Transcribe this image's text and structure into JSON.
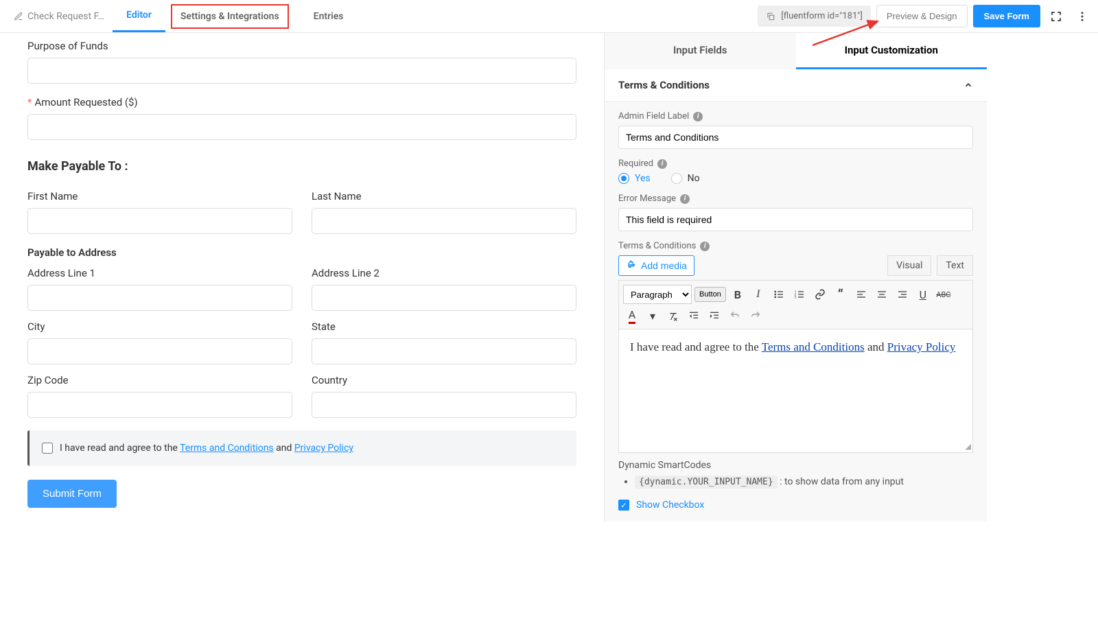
{
  "topbar": {
    "form_name": "Check Request F…",
    "tabs": {
      "editor": "Editor",
      "settings": "Settings & Integrations",
      "entries": "Entries"
    },
    "shortcode": "[fluentform id=\"181\"]",
    "preview": "Preview & Design",
    "save": "Save Form"
  },
  "main": {
    "purpose_label": "Purpose of Funds",
    "amount_label": "Amount Requested ($)",
    "section_payable": "Make Payable To :",
    "first_name": "First Name",
    "last_name": "Last Name",
    "payable_address": "Payable to Address",
    "addr1": "Address Line 1",
    "addr2": "Address Line 2",
    "city": "City",
    "state": "State",
    "zip": "Zip Code",
    "country": "Country",
    "terms_prefix": "I have read and agree to the ",
    "terms_link": "Terms and Conditions",
    "terms_mid": " and ",
    "privacy_link": "Privacy Policy",
    "submit": "Submit Form"
  },
  "panel": {
    "tab_fields": "Input Fields",
    "tab_custom": "Input Customization",
    "section": "Terms & Conditions",
    "admin_label": "Admin Field Label",
    "admin_value": "Terms and Conditions",
    "required": "Required",
    "yes": "Yes",
    "no": "No",
    "error_label": "Error Message",
    "error_value": "This field is required",
    "tc_label": "Terms & Conditions",
    "add_media": "Add media",
    "visual": "Visual",
    "text_tab": "Text",
    "paragraph": "Paragraph",
    "button_btn": "Button",
    "editor_prefix": "I have read and agree to the ",
    "editor_link1": "Terms and Conditions",
    "editor_mid": " and ",
    "editor_link2": "Privacy Policy",
    "smart_label": "Dynamic SmartCodes",
    "smart_code": "{dynamic.YOUR_INPUT_NAME}",
    "smart_desc": ": to show data from any input",
    "show_checkbox": "Show Checkbox"
  }
}
